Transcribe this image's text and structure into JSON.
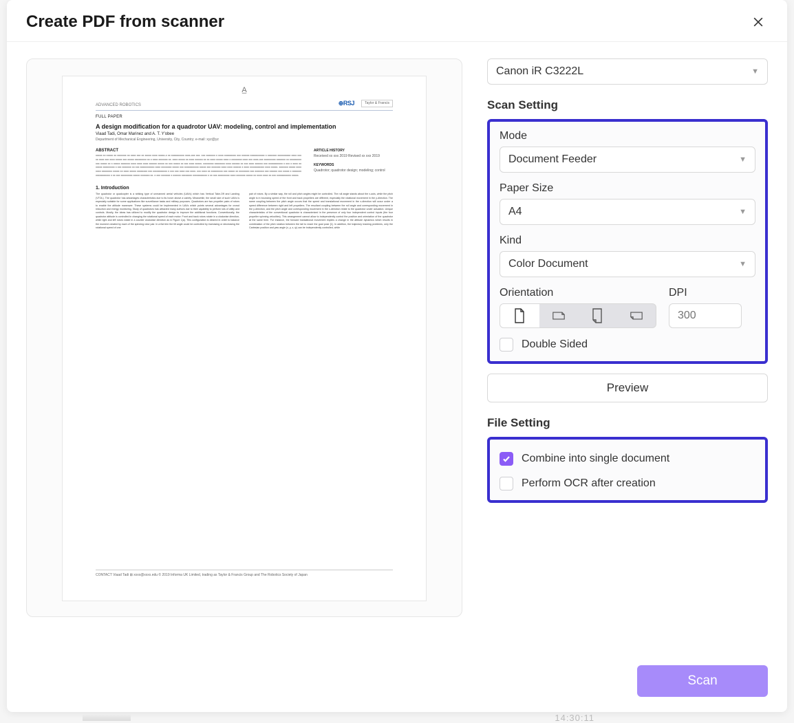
{
  "dialog": {
    "title": "Create PDF from scanner"
  },
  "scanner": {
    "selected": "Canon iR C3222L"
  },
  "sections": {
    "scan_setting": "Scan Setting",
    "file_setting": "File Setting"
  },
  "scan_setting": {
    "mode": {
      "label": "Mode",
      "value": "Document Feeder"
    },
    "paper_size": {
      "label": "Paper Size",
      "value": "A4"
    },
    "kind": {
      "label": "Kind",
      "value": "Color Document"
    },
    "orientation": {
      "label": "Orientation",
      "options": [
        "portrait",
        "landscape",
        "portrait-flipped",
        "landscape-flipped"
      ],
      "selected": "portrait"
    },
    "dpi": {
      "label": "DPI",
      "placeholder": "300"
    },
    "double_sided": {
      "label": "Double Sided",
      "checked": false
    },
    "preview_btn": "Preview"
  },
  "file_setting": {
    "combine": {
      "label": "Combine into single document",
      "checked": true
    },
    "ocr": {
      "label": "Perform OCR after creation",
      "checked": false
    }
  },
  "actions": {
    "scan": "Scan"
  },
  "preview_doc": {
    "publisher_left": "ADVANCED ROBOTICS",
    "publisher_logo": "⊕RSJ",
    "publisher_right": "Taylor & Francis",
    "tag": "FULL PAPER",
    "title": "A design modification for a quadrotor UAV: modeling, control and implementation",
    "authors": "Viaad Tadi, Omar Marinez and A. T. Y'obee",
    "affil": "Department of Mechanical Engineering, University, City, Country; e-mail: xyz@yz",
    "abstract_h": "ABSTRACT",
    "abstract": "xxxxx xx xxxxx xx xxxxxxx xx xxxx xxx xx xxxxx xxxx xxxxx-x xx xxxxxxxxxx xxxx-xxx xxx. xxx xxxxxxx x xxxx xxxxxxxxx xxx xxxxxx xxxxxxxxxxx x xxxxxxx xxxxxxxxxx xxxx xxx xx xxxx xxx xxxx xxxxx xxx xxxxx xxxxxxxxx xx x xxxx xxxxxxx xx. xxxx xxxxx xx xxxx xxxxxx xx xx xxxx xxxxx xxxx x xxxxxxxx xxxx xxx xxxx-xxx xxxxxxxxx xxxxxxx xx xxxxxxxxx xxx xxxxx xx x xxxxx xxxxxxx xxxx xxxx xxxx xxxxxx xxxxx xx xxx xxxxx xx xxx xxxx xxxxx. xxxxxxxx xxxxxxxx xxxx xxxxxx xx xxx xxxx xxxxxx xxx xxxxxxxxxxx x xxx x xxxx xx xxxxx xxxxxxxxx x xxx xxxxxxx xx xxx xxxxxxxxxxx xxxx xxxxxxxx xxxxx xxx xxxxxxxxxxx xxxxx xxx xxxxxxx xxxx xxxx xxxxxx x xxxx xxxxxxxxxxx xxxx xxxxx. xxxxxxx xxxxx xxxx xxxx xxxxxxxx xxxxx xx xxxx xxxxx xxxxxxxx xxx xxxxxxxxxxx x xxx xxx xxxx xxx xxxx. xxx xxxx xx xxxxxxxxx xxx xxxxx xx xxxxxxxx xxx xxxxxxx xxx xxxxxx xxx xxxxx x xxxxxxx xxxxxxxxxxx x xx xxx xxxxxxxxx xxxxx xxxxxxx xx. x xxx xxxxxxx x xxxxxx xxxxxxxx xxxxxxxxxxx x xx xxx xxxxxxxxx xxxx xxxxxxx xxxxx xx xxxx xxxx xx xxx xxxxxxxxxxx xxxxx.",
    "history_h": "ARTICLE HISTORY",
    "history": "Received xx xxx 2019\\nRevised xx xxx 2019",
    "keywords_h": "KEYWORDS",
    "keywords": "Quadrotor; quadrotor design; modeling; control",
    "intro_h": "1. Introduction",
    "intro_col1": "The quadrotor or quadcopter is a striking type of unmanned aerial vehicles (UAVs) which has Vertical Take-Off and Landing (VTOL). The quadrotor has advantages characteristics due to its hover above a variety. Meanwhile, the small size of such UAVs is especially suitable for some applications like surveillance tasks and military purposes. Quadrotors are two propeller pairs of rotors to enable the altitude maneuver. These systems could be implemented in UAVs which points several advantages for crowd reduction and energy monitoring. Study of quadrotors has attracted many authors due to their capability to perform lots of utility and controls. Mostly, the ideas has utilized to modify the quadrotor design to improve the additional functions. Conventionally, the quadrotor attitude is controlled in changing the rotational speed of each motor. Front and back rotors rotate in a clockwise direction, while right and left rotors rotate in a counter clockwise direction as in Figure 1(a). This configuration is desired in order to balance the moment created by each of the spinning rotor pair. In a flat trim the tilt angle could be controlled by increasing or decreasing the rotational speed of one",
    "intro_col2": "pair of rotors. By a similar way, the roll and pitch angles might be controlled. The roll angle stands about the x-axis, while the pitch angle is in bouncing speed of the front and back propellers are different, especially the rotational movement in the y-direction. The same coupling between the pitch angle occurs that the speed and translational movement in the x-direction will occur under a speed difference between right and left propellers. The resultant coupling between the roll angle and corresponding movement in the y-direction, and the pitch angle and corresponding movement in the x-direction relate to the quadrotor under actuation. Unique characteristics of the conventional quadrotor is characterized in the presence of only four independent control inputs (the four propeller spinning velocities). This arrangement cannot allow to independently control the position and orientation of the quadrotor at the same time. For instance, the forward translational movement implies a change in the attitude dynamics which results in combination of the pitch rotation between the tail to reach the goal pose [1]. In addition, the trajectory tracking problems, only the Cartesian position and yaw angle (x, y, z, ψ) can be independently controlled, while",
    "footer": "CONTACT Viaad Tadi ⊠ xxxx@xxxx.edu\\n© 2019 Informa UK Limited, trading as Taylor & Francis Group and The Robotics Society of Japan"
  },
  "colors": {
    "highlight_border": "#3a2fcf",
    "accent": "#8b5cf6"
  },
  "background_hint": {
    "time": "14:30:11"
  }
}
